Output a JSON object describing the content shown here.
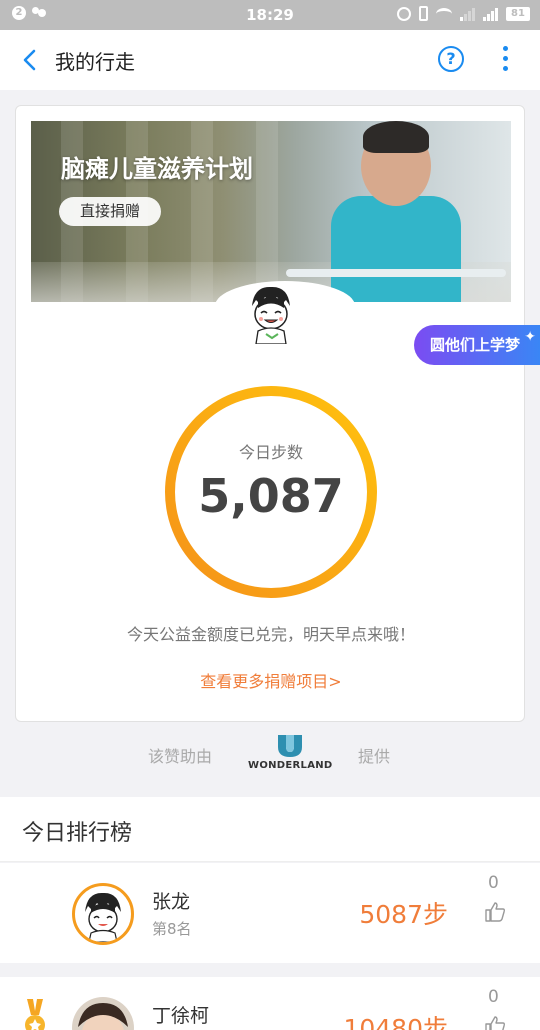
{
  "status_bar": {
    "notif_count": "2",
    "time": "18:29",
    "battery": "81"
  },
  "nav": {
    "title": "我的行走",
    "help_label": "?"
  },
  "banner": {
    "title": "脑瘫儿童滋养计划",
    "donate_label": "直接捐赠"
  },
  "promo": {
    "label": "圆他们上学梦"
  },
  "steps": {
    "label": "今日步数",
    "value": "5,087",
    "notice": "今天公益金额度已兑完，明天早点来哦！",
    "more_link": "查看更多捐赠项目>"
  },
  "sponsor": {
    "prefix": "该赞助由",
    "logo_text": "WONDERLAND",
    "suffix": "提供"
  },
  "leaderboard": {
    "title": "今日排行榜",
    "rows": [
      {
        "name": "张龙",
        "rank": "第8名",
        "steps": "5087步",
        "likes": "0"
      },
      {
        "name": "丁徐柯",
        "rank": "",
        "steps": "10480步",
        "likes": "0"
      }
    ]
  },
  "colors": {
    "accent_blue": "#1a8bf0",
    "orange": "#f07d3a",
    "ring_start": "#f7a21b",
    "ring_end": "#ffc107"
  }
}
